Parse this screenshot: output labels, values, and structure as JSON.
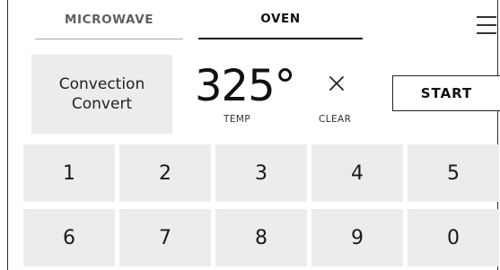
{
  "tabs": {
    "microwave": "MICROWAVE",
    "oven": "OVEN",
    "active": "OVEN"
  },
  "menu": {
    "icon": "hamburger-menu-icon"
  },
  "convection": {
    "label": "Convection\nConvert"
  },
  "temperature": {
    "value": "325°",
    "label": "TEMP"
  },
  "clear": {
    "icon": "close-x-icon",
    "label": "CLEAR"
  },
  "start": {
    "label": "START"
  },
  "keypad": {
    "keys": [
      "1",
      "2",
      "3",
      "4",
      "5",
      "6",
      "7",
      "8",
      "9",
      "0"
    ]
  },
  "colors": {
    "key_background": "#ececec",
    "active_tab_underline": "#111111",
    "inactive_tab_underline": "#a8a8a8"
  }
}
